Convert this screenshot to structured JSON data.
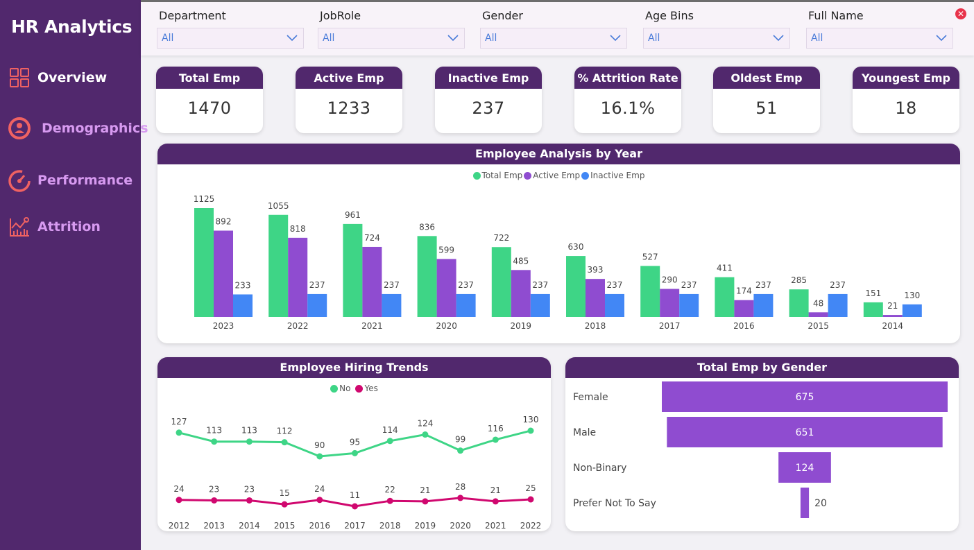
{
  "sidebar": {
    "title": "HR Analytics",
    "items": [
      {
        "label": "Overview",
        "icon": "dashboard-grid-icon"
      },
      {
        "label": "Demographics",
        "icon": "user-circle-icon"
      },
      {
        "label": "Performance",
        "icon": "speedometer-icon"
      },
      {
        "label": "Attrition",
        "icon": "chart-trend-icon"
      }
    ]
  },
  "filters": [
    {
      "label": "Department",
      "value": "All"
    },
    {
      "label": "JobRole",
      "value": "All"
    },
    {
      "label": "Gender",
      "value": "All"
    },
    {
      "label": "Age Bins",
      "value": "All"
    },
    {
      "label": "Full Name",
      "value": "All"
    }
  ],
  "kpis": [
    {
      "label": "Total Emp",
      "value": "1470"
    },
    {
      "label": "Active Emp",
      "value": "1233"
    },
    {
      "label": "Inactive Emp",
      "value": "237"
    },
    {
      "label": "% Attrition Rate",
      "value": "16.1%"
    },
    {
      "label": "Oldest Emp",
      "value": "51"
    },
    {
      "label": "Youngest Emp",
      "value": "18"
    }
  ],
  "colors": {
    "purple_dark": "#51286d",
    "green": "#3ed586",
    "purple": "#8f4cd0",
    "blue": "#4287f5",
    "magenta": "#d0086f",
    "gender_bar": "#8f4cd0"
  },
  "chart_data": [
    {
      "type": "bar",
      "title": "Employee Analysis by Year",
      "categories": [
        "2023",
        "2022",
        "2021",
        "2020",
        "2019",
        "2018",
        "2017",
        "2016",
        "2015",
        "2014"
      ],
      "series": [
        {
          "name": "Total Emp",
          "values": [
            1125,
            1055,
            961,
            836,
            722,
            630,
            527,
            411,
            285,
            151
          ]
        },
        {
          "name": "Active Emp",
          "values": [
            892,
            818,
            724,
            599,
            485,
            393,
            290,
            174,
            48,
            21
          ]
        },
        {
          "name": "Inactive Emp",
          "values": [
            233,
            237,
            237,
            237,
            237,
            237,
            237,
            237,
            237,
            130
          ]
        }
      ],
      "legend": "top-center",
      "grid": false
    },
    {
      "type": "line",
      "title": "Employee Hiring Trends",
      "x": [
        "2012",
        "2013",
        "2014",
        "2015",
        "2016",
        "2017",
        "2018",
        "2019",
        "2020",
        "2021",
        "2022"
      ],
      "series": [
        {
          "name": "No",
          "values": [
            127,
            113,
            113,
            112,
            90,
            95,
            114,
            124,
            99,
            116,
            130
          ]
        },
        {
          "name": "Yes",
          "values": [
            24,
            23,
            23,
            15,
            24,
            11,
            22,
            21,
            28,
            21,
            25
          ]
        }
      ],
      "legend": "top-center",
      "grid": false
    },
    {
      "type": "funnel",
      "title": "Total Emp by Gender",
      "categories": [
        "Female",
        "Male",
        "Non-Binary",
        "Prefer Not To Say"
      ],
      "values": [
        675,
        651,
        124,
        20
      ]
    }
  ]
}
